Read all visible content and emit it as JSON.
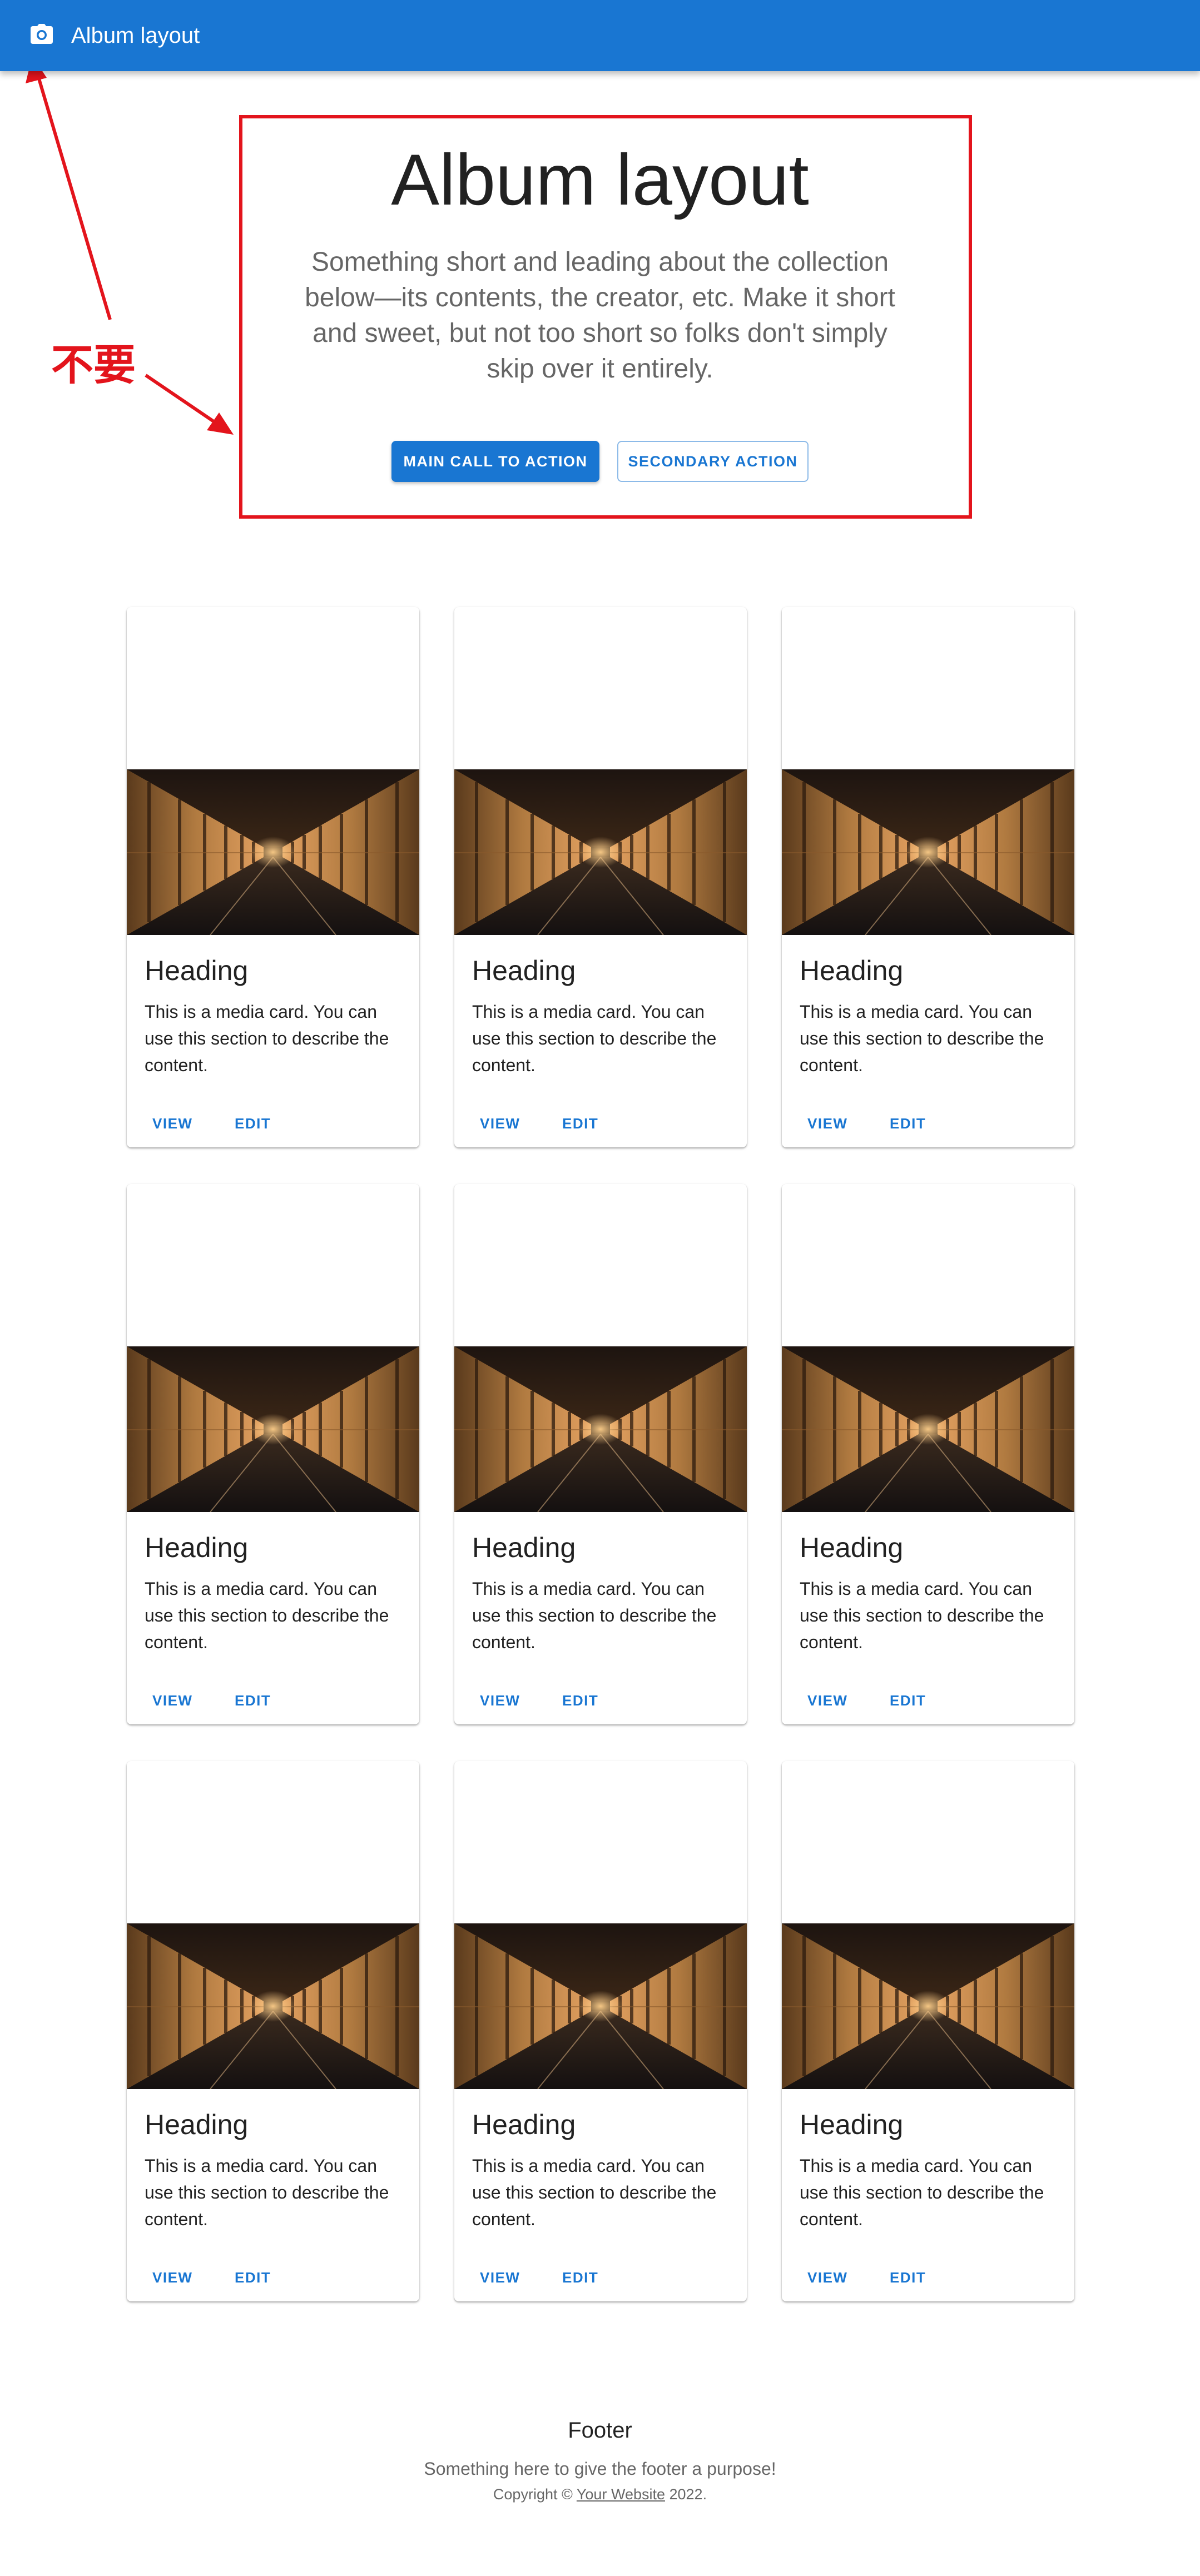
{
  "appbar": {
    "title": "Album layout",
    "icon": "camera-icon",
    "color": "#1976d2"
  },
  "hero": {
    "title": "Album layout",
    "lead": "Something short and leading about the collection below—its contents, the creator, etc. Make it short and sweet, but not too short so folks don't simply skip over it entirely.",
    "main_action": "MAIN CALL TO ACTION",
    "secondary_action": "SECONDARY ACTION"
  },
  "annotation": {
    "label": "不要",
    "color": "#e3141c"
  },
  "cards": [
    {
      "heading": "Heading",
      "description": "This is a media card. You can use this section to describe the content.",
      "view": "VIEW",
      "edit": "EDIT"
    },
    {
      "heading": "Heading",
      "description": "This is a media card. You can use this section to describe the content.",
      "view": "VIEW",
      "edit": "EDIT"
    },
    {
      "heading": "Heading",
      "description": "This is a media card. You can use this section to describe the content.",
      "view": "VIEW",
      "edit": "EDIT"
    },
    {
      "heading": "Heading",
      "description": "This is a media card. You can use this section to describe the content.",
      "view": "VIEW",
      "edit": "EDIT"
    },
    {
      "heading": "Heading",
      "description": "This is a media card. You can use this section to describe the content.",
      "view": "VIEW",
      "edit": "EDIT"
    },
    {
      "heading": "Heading",
      "description": "This is a media card. You can use this section to describe the content.",
      "view": "VIEW",
      "edit": "EDIT"
    },
    {
      "heading": "Heading",
      "description": "This is a media card. You can use this section to describe the content.",
      "view": "VIEW",
      "edit": "EDIT"
    },
    {
      "heading": "Heading",
      "description": "This is a media card. You can use this section to describe the content.",
      "view": "VIEW",
      "edit": "EDIT"
    },
    {
      "heading": "Heading",
      "description": "This is a media card. You can use this section to describe the content.",
      "view": "VIEW",
      "edit": "EDIT"
    }
  ],
  "footer": {
    "title": "Footer",
    "subtitle": "Something here to give the footer a purpose!",
    "copyright_prefix": "Copyright © ",
    "link": "Your Website",
    "year": " 2022."
  }
}
